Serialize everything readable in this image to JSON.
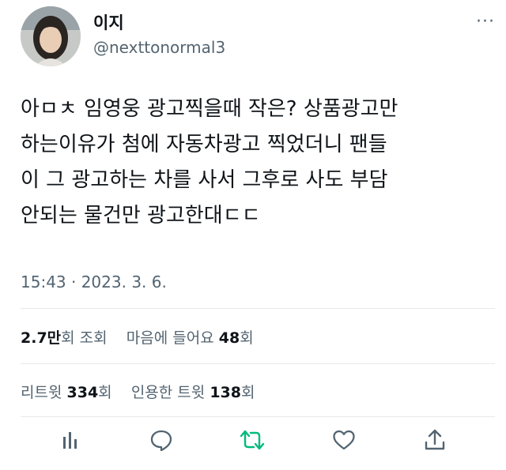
{
  "user": {
    "display_name": "이지",
    "handle": "@nexttonormal3"
  },
  "tweet": {
    "text": "아ㅁㅊ 임영웅 광고찍을때 작은? 상품광고만\n하는이유가 첨에 자동차광고 찍었더니 팬들\n이 그 광고하는 차를 사서 그후로 사도 부담\n안되는 물건만 광고한대ㄷㄷ",
    "timestamp": "15:43 · 2023. 3. 6."
  },
  "stats": {
    "views_value": "2.7만",
    "views_label": "회 조회",
    "likes_prefix": "마음에 들어요",
    "likes_value": "48",
    "likes_suffix": "회",
    "retweets_label": "리트윗",
    "retweets_value": "334",
    "retweets_suffix": "회",
    "quotes_label": "인용한 트윗",
    "quotes_value": "138",
    "quotes_suffix": "회"
  },
  "actions": {
    "analytics_icon": "bar-chart-icon",
    "reply_icon": "reply-icon",
    "retweet_icon": "retweet-icon",
    "like_icon": "heart-icon",
    "share_icon": "share-icon"
  },
  "colors": {
    "text": "#0f1419",
    "secondary": "#536471",
    "retweet_green": "#00ba7c",
    "divider": "#e6e9ec"
  }
}
